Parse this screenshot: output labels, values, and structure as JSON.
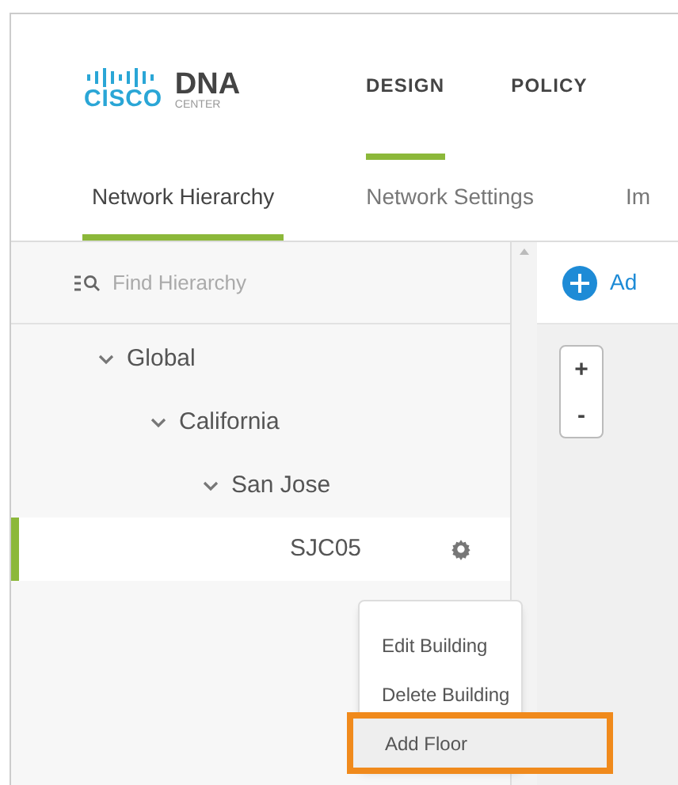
{
  "logo": {
    "brand": "CISCO",
    "product": "DNA",
    "subtitle": "CENTER"
  },
  "nav": [
    {
      "label": "DESIGN",
      "selected": true
    },
    {
      "label": "POLICY",
      "selected": false
    }
  ],
  "subtabs": [
    {
      "label": "Network Hierarchy",
      "selected": true
    },
    {
      "label": "Network Settings",
      "selected": false
    },
    {
      "label": "Im",
      "selected": false
    }
  ],
  "search": {
    "placeholder": "Find Hierarchy"
  },
  "tree": [
    {
      "label": "Global",
      "expanded": true,
      "selected": false,
      "children": [
        {
          "label": "California",
          "expanded": true,
          "selected": false,
          "children": [
            {
              "label": "San Jose",
              "expanded": true,
              "selected": false,
              "children": [
                {
                  "label": "SJC05",
                  "selected": true
                }
              ]
            }
          ]
        }
      ]
    }
  ],
  "add_button": {
    "label": "Ad"
  },
  "zoom": {
    "in": "+",
    "out": "-"
  },
  "context_menu": [
    {
      "label": "Edit Building",
      "highlighted": false
    },
    {
      "label": "Delete Building",
      "highlighted": false
    },
    {
      "label": "Add Floor",
      "highlighted": true
    }
  ]
}
